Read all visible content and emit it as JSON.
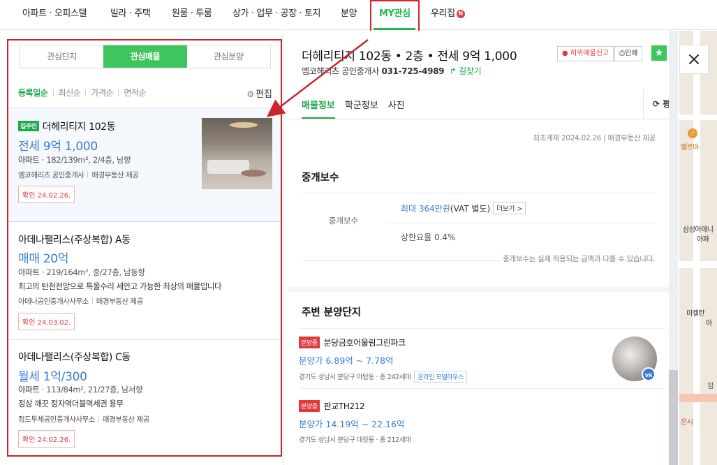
{
  "nav": {
    "items": [
      "아파트 · 오피스텔",
      "빌라 · 주택",
      "원룸 · 투룸",
      "상가 · 업무 · 공장 · 토지",
      "분양",
      "MY관심",
      "우리집"
    ],
    "new_badge": "N"
  },
  "left": {
    "tabs": [
      "관심단지",
      "관심매물",
      "관심분양"
    ],
    "sort": [
      "등록일순",
      "최신순",
      "가격순",
      "면적순"
    ],
    "edit_label": "편집",
    "listings": [
      {
        "badge": "집주인",
        "title": "더헤리티지 102동",
        "price": "전세 9억 1,000",
        "type": "아파트",
        "spec": "182/139m², 2/4층, 남향",
        "desc": "",
        "agent": "엠코헤리츠 공인중개사",
        "provider": "매경부동산 제공",
        "confirmed": "확인 24.02.26."
      },
      {
        "badge": "",
        "title": "아데나팰리스(주상복합) A동",
        "price": "매매 20억",
        "type": "아파트",
        "spec": "219/164m², 중/27층, 남동향",
        "desc": "최고의 탄천전망으로 특올수리 세안고 가능한 최상의 매물입니다",
        "agent": "아데나공인중개사사무소",
        "provider": "매경부동산 제공",
        "confirmed": "확인 24.03.02."
      },
      {
        "badge": "",
        "title": "아데나팰리스(주상복합) C동",
        "price": "월세 1억/300",
        "type": "아파트",
        "spec": "113/84m², 21/27층, 남서향",
        "desc": "정상 깨끗 정자역더블역세권 용무",
        "agent": "정드투체공인중개사사무소",
        "provider": "매경부동산 제공",
        "confirmed": "확인 24.02.26."
      }
    ]
  },
  "detail": {
    "title": "더헤리티지 102동 • 2층 • 전세 9억 1,000",
    "agent": "엠코헤리츠 공인중개사",
    "phone": "031-725-4989",
    "route": "길찾기",
    "report_btn": "허위매물신고",
    "print_btn": "인쇄",
    "tabs": [
      "매물정보",
      "학군정보",
      "사진"
    ],
    "refresh_label": "평",
    "first_reg": "최초게재 2024.02.26 | 매경부동산 제공",
    "fee": {
      "section_title": "중개보수",
      "label": "중개보수",
      "max_value": "최대 364만원",
      "vat": "(VAT 별도)",
      "more": "더보기 >",
      "rate": "상한요율  0.4%",
      "note": "중개보수는 실제 적용되는 금액과 다를 수 있습니다."
    },
    "nearby": {
      "section_title": "주변 분양단지",
      "items": [
        {
          "badge": "분양중",
          "name": "분당금호어울림그린파크",
          "price": "분양가 6.89억 ~ 7.78억",
          "loc": "경기도 성남시 분당구 야탑동 · 총 242세대",
          "tag": "온라인 모델하우스"
        },
        {
          "badge": "분양중",
          "name": "판교TH212",
          "price": "분양가 14.19억 ~ 22.16억",
          "loc": "경기도 성남시 분당구 대장동 · 총 212세대",
          "tag": ""
        }
      ]
    }
  },
  "map": {
    "labels": [
      "벨르마",
      "삼성아데니",
      "아파",
      "미켈란",
      "아",
      "은시",
      "임"
    ],
    "vr_badge": "VR"
  },
  "colors": {
    "accent_green": "#1fb74f",
    "highlight_red": "#d7232a",
    "price_blue": "#3a7bd5"
  }
}
